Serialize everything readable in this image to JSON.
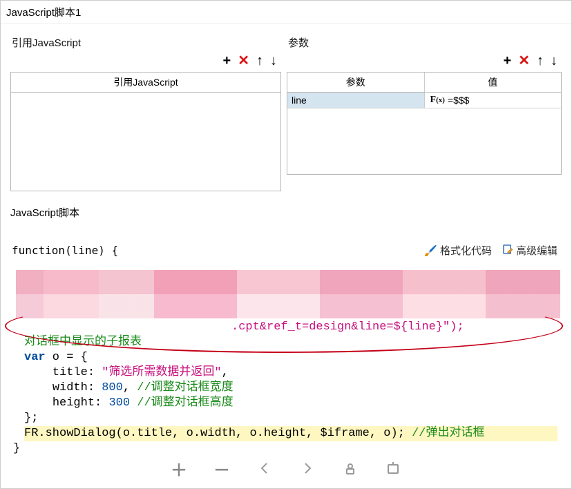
{
  "title": "JavaScript脚本1",
  "refjs": {
    "label": "引用JavaScript",
    "column_header": "引用JavaScript"
  },
  "params": {
    "label": "参数",
    "columns": {
      "name": "参数",
      "value": "值"
    },
    "rows": [
      {
        "name": "line",
        "value": "=$$$"
      }
    ]
  },
  "fx_symbol": {
    "F": "F",
    "x": "(x)"
  },
  "toolbar_icons": {
    "add": "+",
    "remove": "✕",
    "up": "↑",
    "down": "↓"
  },
  "script": {
    "label": "JavaScript脚本",
    "signature": "function(line) {",
    "format_link": "格式化代码",
    "advanced_link": "高级编辑",
    "partial_visible": ".cpt&ref_t=design&line=${line}\");",
    "comment_partial": "对话框中显示的子报表",
    "comment_prefix_hidden": "//数据回填_弹窗.cpt为点击查询时，",
    "lines": {
      "var": "var",
      "odecl": " o = {",
      "title_key": "title",
      "title_val": "\"筛选所需数据并返回\"",
      "width_key": "width",
      "width_val": "800",
      "width_com": "//调整对话框宽度",
      "height_key": "height",
      "height_val": "300",
      "height_com": "//调整对话框高度",
      "close_obj": "};",
      "show": "FR.showDialog(o.title, o.width, o.height, $iframe, o);",
      "show_com": " //弹出对话框",
      "close_fn": "}"
    }
  }
}
